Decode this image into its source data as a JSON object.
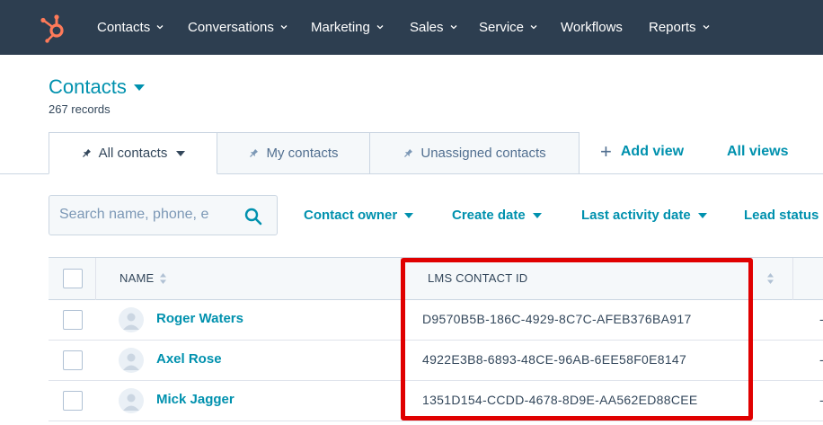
{
  "nav": {
    "items": [
      {
        "label": "Contacts",
        "dropdown": true
      },
      {
        "label": "Conversations",
        "dropdown": true
      },
      {
        "label": "Marketing",
        "dropdown": true
      },
      {
        "label": "Sales",
        "dropdown": true
      },
      {
        "label": "Service",
        "dropdown": true
      },
      {
        "label": "Workflows",
        "dropdown": false
      },
      {
        "label": "Reports",
        "dropdown": true
      }
    ],
    "logo_icon": "hubspot-sprocket-icon",
    "colors": {
      "bar": "#2d3e50",
      "logo": "#ff7a59"
    }
  },
  "header": {
    "title": "Contacts",
    "record_count": "267 records"
  },
  "tabs": [
    {
      "label": "All contacts",
      "active": true
    },
    {
      "label": "My contacts",
      "active": false
    },
    {
      "label": "Unassigned contacts",
      "active": false
    }
  ],
  "views": {
    "add_view": "Add view",
    "all_views": "All views"
  },
  "filters": {
    "search_placeholder": "Search name, phone, e",
    "items": [
      "Contact owner",
      "Create date",
      "Last activity date",
      "Lead status"
    ]
  },
  "table": {
    "columns": [
      "NAME",
      "LMS CONTACT ID"
    ],
    "rows": [
      {
        "name": "Roger Waters",
        "lms_contact_id": "D9570B5B-186C-4929-8C7C-AFEB376BA917",
        "trailing": "-"
      },
      {
        "name": "Axel Rose",
        "lms_contact_id": "4922E3B8-6893-48CE-96AB-6EE58F0E8147",
        "trailing": "-"
      },
      {
        "name": "Mick Jagger",
        "lms_contact_id": "1351D154-CCDD-4678-8D9E-AA562ED88CEE",
        "trailing": "-"
      }
    ]
  },
  "annotation": {
    "highlight_color": "#e00000"
  },
  "accent_color": "#0091ae"
}
